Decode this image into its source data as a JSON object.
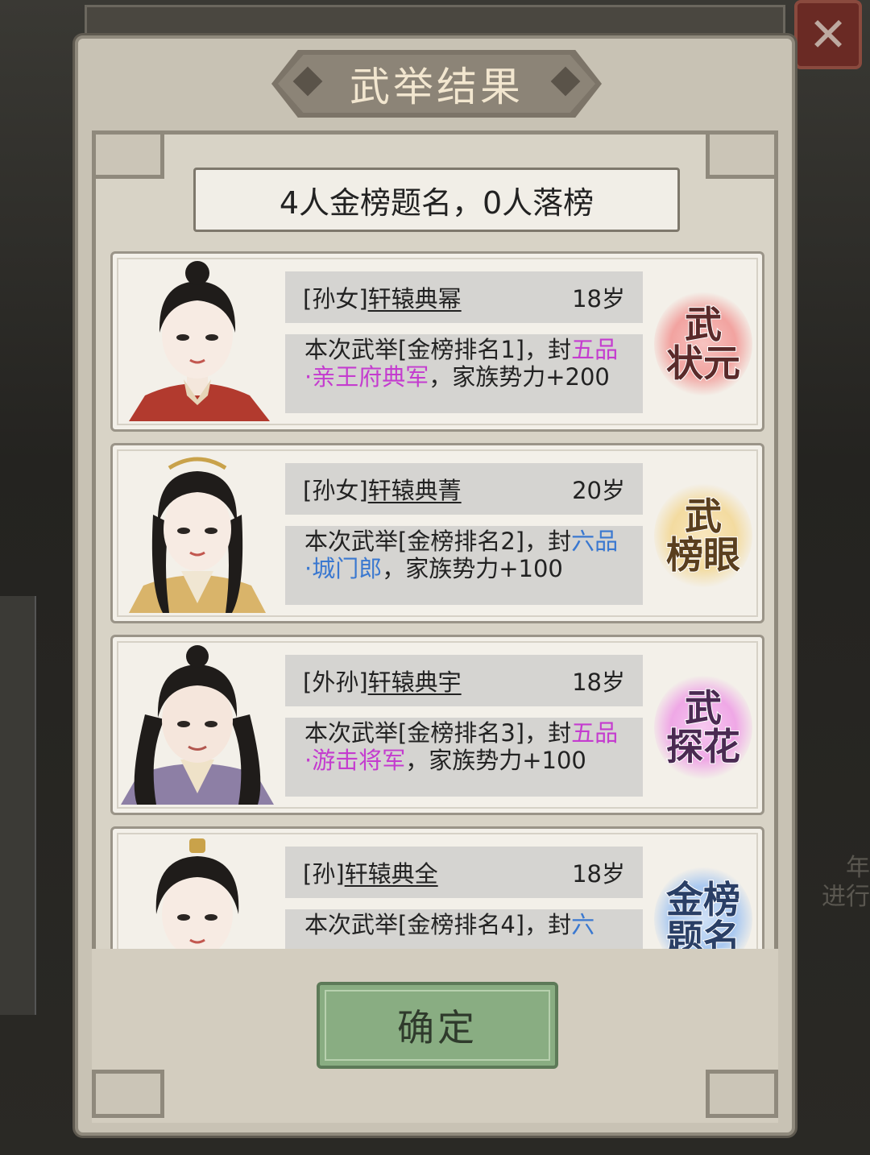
{
  "background": {
    "right_text_lines": [
      "年",
      "进行"
    ]
  },
  "close_button": {
    "icon": "close-icon",
    "glyph": "✕"
  },
  "dialog": {
    "title": "武举结果",
    "summary": "4人金榜题名，0人落榜",
    "confirm_label": "确定"
  },
  "results": [
    {
      "relation": "[孙女]",
      "name": "轩辕典幂",
      "age": "18岁",
      "desc_before": "本次武举[金榜排名1]，封",
      "rank": "五品·亲王府典军",
      "rank_color": "purple",
      "desc_after": "，家族势力+200",
      "seal": "武\n状元",
      "seal_color": "#f2a3a0",
      "portrait": {
        "robe": "#b23a2e",
        "collar": "#e6d5b8"
      }
    },
    {
      "relation": "[孙女]",
      "name": "轩辕典菁",
      "age": "20岁",
      "desc_before": "本次武举[金榜排名2]，封",
      "rank": "六品·城门郎",
      "rank_color": "blue",
      "desc_after": "，家族势力+100",
      "seal": "武\n榜眼",
      "seal_color": "#f3dba0",
      "portrait": {
        "robe": "#d9b46a",
        "collar": "#f0e6d2"
      }
    },
    {
      "relation": "[外孙]",
      "name": "轩辕典宇",
      "age": "18岁",
      "desc_before": "本次武举[金榜排名3]，封",
      "rank": "五品·游击将军",
      "rank_color": "purple",
      "desc_after": "，家族势力+100",
      "seal": "武\n探花",
      "seal_color": "#efa8e6",
      "portrait": {
        "robe": "#8d7fa5",
        "collar": "#efe2c8"
      }
    },
    {
      "relation": "[孙]",
      "name": "轩辕典全",
      "age": "18岁",
      "desc_before": "本次武举[金榜排名4]，封",
      "rank": "六",
      "rank_color": "blue",
      "desc_after": "",
      "seal": "金榜\n题名",
      "seal_color": "#a9c8f0",
      "portrait": {
        "robe": "#6d7f93",
        "collar": "#efe2c8"
      }
    }
  ]
}
